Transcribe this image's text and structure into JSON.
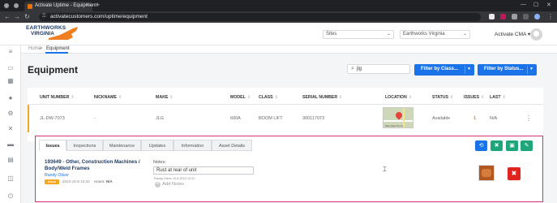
{
  "browser": {
    "tab_title": "Activate Uptime - Equipment",
    "tab_close": "×",
    "new_tab": "+",
    "url": "activatecustomers.com/uptime/equipment",
    "window_controls": {
      "minimize": "—",
      "maximize": "☐",
      "close": "✕"
    },
    "icons": [
      "back-icon",
      "forward-icon",
      "reload-icon",
      "lock-icon",
      "extension-icon",
      "profile-icon",
      "menu-icon"
    ]
  },
  "header": {
    "logo_line1": "EARTHWORKS",
    "logo_line2": "VIRGINIA",
    "sites_select": "Sites",
    "company_select": "Earthworks Virginia",
    "account_label": "Activate CMA ▾"
  },
  "sidebar": {
    "icons": [
      "menu-icon",
      "dashboard-icon",
      "grid-icon",
      "user-icon",
      "settings-icon",
      "wrench-icon",
      "truck-icon",
      "document-icon",
      "tools-icon",
      "logout-icon"
    ]
  },
  "breadcrumb": {
    "home": "Home",
    "separator": ">",
    "current": "Equipment"
  },
  "page": {
    "title": "Equipment",
    "search_value": "jlg",
    "filter_class": "Filter by Class...",
    "filter_status": "Filter by Status..."
  },
  "table": {
    "columns": [
      "UNIT NUMBER",
      "NICKNAME",
      "MAKE",
      "MODEL",
      "CLASS",
      "SERIAL NUMBER",
      "LOCATION",
      "STATUS",
      "ISSUES",
      "LAST"
    ],
    "sort_glyph": "⇕",
    "row": {
      "unit_number": "JL-DW-7073",
      "nickname": "-",
      "make": "JLG",
      "model": "600A",
      "class": "BOOM LIFT",
      "serial": "300117073",
      "location_caption": "Map Data  Terms",
      "status": "Available",
      "issues": "1",
      "last": "N/A",
      "kebab": "⋮"
    }
  },
  "detail": {
    "tabs": [
      "Issues",
      "Inspections",
      "Maintenance",
      "Updates",
      "Information",
      "Asset Details"
    ],
    "active_tab": "Issues",
    "action_buttons": [
      {
        "icon": "history-icon",
        "glyph": "⟲",
        "color": "#1a73e8"
      },
      {
        "icon": "wrench-cross-icon",
        "glyph": "✖",
        "color": "#1ea67a"
      },
      {
        "icon": "clipboard-icon",
        "glyph": "▣",
        "color": "#1ea67a"
      },
      {
        "icon": "edit-icon",
        "glyph": "✎",
        "color": "#1ea67a"
      }
    ],
    "issue": {
      "title": "193649 - Other, Construction Machines / Body/Weld Frames",
      "reporter": "Randy Oliver",
      "badge": "Issue",
      "date": "2024-10-8 13:22",
      "hours_label": "Hours:",
      "hours_value": "N/A",
      "notes_label": "Notes:",
      "note_text": "Rust at rear of unit",
      "note_meta": "Randy Oliver 10.8.2024 13:22",
      "add_notes": "Add Notes",
      "delete_glyph": "✖"
    }
  }
}
